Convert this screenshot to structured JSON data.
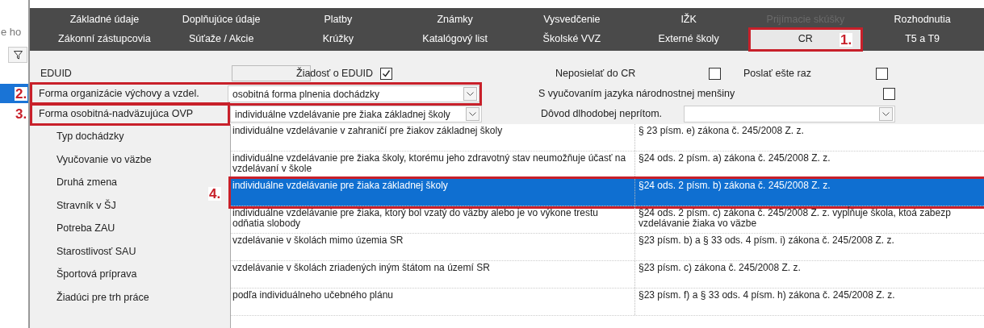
{
  "side_panel": {
    "text": "e ho"
  },
  "tabs": [
    [
      {
        "label": "Základné údaje",
        "selected": false,
        "disabled": false
      },
      {
        "label": "Doplňujúce údaje",
        "selected": false,
        "disabled": false
      },
      {
        "label": "Platby",
        "selected": false,
        "disabled": false
      },
      {
        "label": "Známky",
        "selected": false,
        "disabled": false
      },
      {
        "label": "Vysvedčenie",
        "selected": false,
        "disabled": false
      },
      {
        "label": "IŽK",
        "selected": false,
        "disabled": false
      },
      {
        "label": "Prijímacie skúšky",
        "selected": false,
        "disabled": true
      },
      {
        "label": "Rozhodnutia",
        "selected": false,
        "disabled": false
      }
    ],
    [
      {
        "label": "Zákonní zástupcovia",
        "selected": false,
        "disabled": false
      },
      {
        "label": "Súťaže / Akcie",
        "selected": false,
        "disabled": false
      },
      {
        "label": "Krúžky",
        "selected": false,
        "disabled": false
      },
      {
        "label": "Katalógový list",
        "selected": false,
        "disabled": false
      },
      {
        "label": "Školské VVZ",
        "selected": false,
        "disabled": false
      },
      {
        "label": "Externé školy",
        "selected": false,
        "disabled": false
      },
      {
        "label": "CR",
        "selected": true,
        "disabled": false,
        "annotation": "1."
      },
      {
        "label": "T5 a T9",
        "selected": false,
        "disabled": false
      }
    ]
  ],
  "eduid": {
    "label": "EDUID",
    "request_label": "Žiadosť o EDUID",
    "request_checked": true,
    "no_send_label": "Neposielať do CR",
    "no_send_checked": false,
    "resend_label": "Poslať ešte raz",
    "resend_checked": false
  },
  "form_row": {
    "label": "Forma organizácie výchovy a vzdel.",
    "value": "osobitná forma plnenia dochádzky",
    "annotation": "2.",
    "minority_label": "S vyučovaním jazyka národnostnej menšiny",
    "minority_checked": false
  },
  "special_row": {
    "label": "Forma osobitná-nadväzujúca OVP",
    "value": "individuálne vzdelávanie pre žiaka základnej školy",
    "annotation": "3.",
    "absence_label": "Dôvod dlhodobej neprítom."
  },
  "labels": [
    "Typ dochádzky",
    "Vyučovanie vo väzbe",
    "Druhá zmena",
    "Stravník v ŠJ",
    "Potreba ZAU",
    "Starostlivosť SAU",
    "Športová príprava",
    "Žiadúci pre trh práce"
  ],
  "dropdown": [
    {
      "form": "individuálne vzdelávanie v zahraničí pre žiakov základnej školy",
      "law": "§ 23 písm. e) zákona č. 245/2008 Z. z.",
      "selected": false
    },
    {
      "form": "individuálne vzdelávanie pre žiaka školy, ktorému jeho zdravotný stav neumožňuje účasť na vzdelávaní v škole",
      "law": "§24 ods. 2 písm. a) zákona č. 245/2008 Z. z.",
      "selected": false
    },
    {
      "form": "individuálne vzdelávanie pre žiaka základnej školy",
      "law": "§24 ods. 2 písm. b) zákona č. 245/2008 Z. z.",
      "selected": true,
      "annotation": "4."
    },
    {
      "form": "individuálne vzdelávanie pre žiaka, ktorý bol vzatý do väzby alebo je vo výkone trestu odňatia slobody",
      "law": "§24 ods. 2 písm. c) zákona č. 245/2008 Z. z.  vypĺňuje škola, ktoá zabezp vzdelávanie žiaka vo väzbe",
      "selected": false
    },
    {
      "form": "vzdelávanie v školách mimo územia SR",
      "law": "§23 písm. b) a § 33 ods. 4 písm. i) zákona č. 245/2008 Z. z.",
      "selected": false
    },
    {
      "form": "vzdelávanie v školách zriadených iným štátom na území SR",
      "law": "§23 písm. c)  zákona č. 245/2008 Z. z.",
      "selected": false
    },
    {
      "form": "podľa individuálneho učebného plánu",
      "law": "§23 písm. f)  a § 33 ods. 4 písm. h) zákona č. 245/2008 Z. z.",
      "selected": false
    }
  ]
}
